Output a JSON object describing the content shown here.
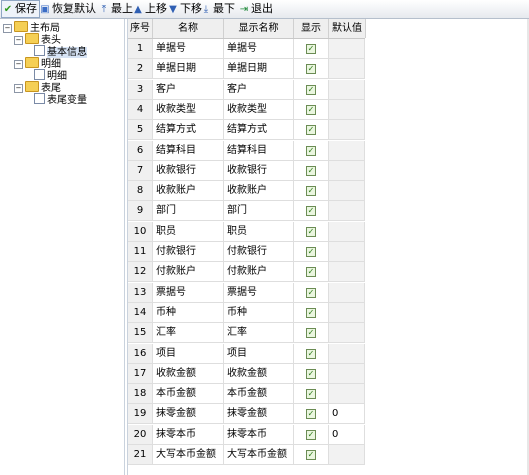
{
  "toolbar": {
    "save": "保存",
    "restore": "恢复默认",
    "top": "最上",
    "up": "上移",
    "down": "下移",
    "bottom": "最下",
    "exit": "退出"
  },
  "tree": {
    "root": "主布局",
    "header": "表头",
    "header_child": "基本信息",
    "detail": "明细",
    "detail_child": "明细",
    "footer": "表尾",
    "footer_child": "表尾变量"
  },
  "table": {
    "columns": [
      "序号",
      "名称",
      "显示名称",
      "显示",
      "默认值"
    ],
    "rows": [
      {
        "num": "1",
        "name": "单据号",
        "display": "单据号",
        "checked": true,
        "default": ""
      },
      {
        "num": "2",
        "name": "单据日期",
        "display": "单据日期",
        "checked": true,
        "default": ""
      },
      {
        "num": "3",
        "name": "客户",
        "display": "客户",
        "checked": true,
        "default": ""
      },
      {
        "num": "4",
        "name": "收款类型",
        "display": "收款类型",
        "checked": true,
        "default": ""
      },
      {
        "num": "5",
        "name": "结算方式",
        "display": "结算方式",
        "checked": true,
        "default": ""
      },
      {
        "num": "6",
        "name": "结算科目",
        "display": "结算科目",
        "checked": true,
        "default": ""
      },
      {
        "num": "7",
        "name": "收款银行",
        "display": "收款银行",
        "checked": true,
        "default": ""
      },
      {
        "num": "8",
        "name": "收款账户",
        "display": "收款账户",
        "checked": true,
        "default": ""
      },
      {
        "num": "9",
        "name": "部门",
        "display": "部门",
        "checked": true,
        "default": ""
      },
      {
        "num": "10",
        "name": "职员",
        "display": "职员",
        "checked": true,
        "default": ""
      },
      {
        "num": "11",
        "name": "付款银行",
        "display": "付款银行",
        "checked": true,
        "default": ""
      },
      {
        "num": "12",
        "name": "付款账户",
        "display": "付款账户",
        "checked": true,
        "default": ""
      },
      {
        "num": "13",
        "name": "票据号",
        "display": "票据号",
        "checked": true,
        "default": ""
      },
      {
        "num": "14",
        "name": "币种",
        "display": "币种",
        "checked": true,
        "default": ""
      },
      {
        "num": "15",
        "name": "汇率",
        "display": "汇率",
        "checked": true,
        "default": ""
      },
      {
        "num": "16",
        "name": "项目",
        "display": "项目",
        "checked": true,
        "default": ""
      },
      {
        "num": "17",
        "name": "收款金额",
        "display": "收款金额",
        "checked": true,
        "default": ""
      },
      {
        "num": "18",
        "name": "本币金额",
        "display": "本币金额",
        "checked": true,
        "default": ""
      },
      {
        "num": "19",
        "name": "抹零金额",
        "display": "抹零金额",
        "checked": true,
        "default": "0"
      },
      {
        "num": "20",
        "name": "抹零本币",
        "display": "抹零本币",
        "checked": true,
        "default": "0"
      },
      {
        "num": "21",
        "name": "大写本币金额",
        "display": "大写本币金额",
        "checked": true,
        "default": ""
      }
    ]
  }
}
